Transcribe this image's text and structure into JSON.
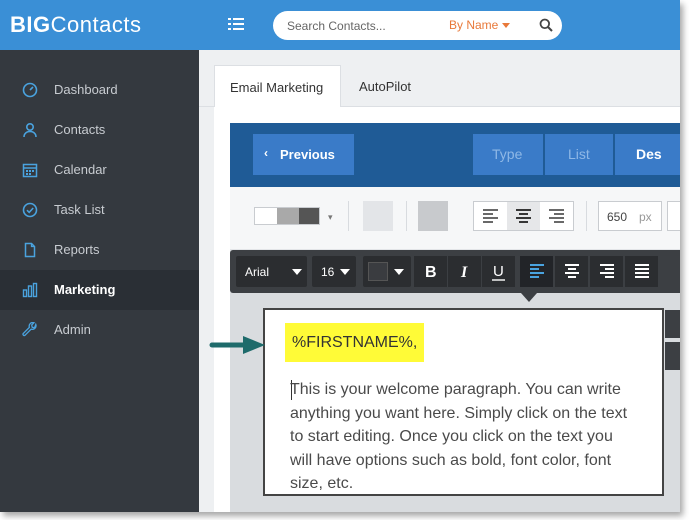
{
  "app": {
    "logo_bold": "BIG",
    "logo_light": "Contacts"
  },
  "search": {
    "placeholder": "Search Contacts...",
    "filter_label": "By Name"
  },
  "sidebar": {
    "items": [
      {
        "label": "Dashboard",
        "icon": "dashboard-gauge-icon",
        "active": false
      },
      {
        "label": "Contacts",
        "icon": "user-icon",
        "active": false
      },
      {
        "label": "Calendar",
        "icon": "calendar-icon",
        "active": false
      },
      {
        "label": "Task List",
        "icon": "check-circle-icon",
        "active": false
      },
      {
        "label": "Reports",
        "icon": "document-icon",
        "active": false
      },
      {
        "label": "Marketing",
        "icon": "bar-chart-icon",
        "active": true
      },
      {
        "label": "Admin",
        "icon": "wrench-icon",
        "active": false
      }
    ]
  },
  "tabs": [
    {
      "label": "Email Marketing",
      "active": true
    },
    {
      "label": "AutoPilot",
      "active": false
    }
  ],
  "wizard": {
    "previous_label": "Previous",
    "steps": [
      "Type",
      "List",
      "Des"
    ]
  },
  "style_toolbar": {
    "width_value": "650",
    "width_unit": "px"
  },
  "text_toolbar": {
    "font_family": "Arial",
    "font_size": "16"
  },
  "editor": {
    "merge_field": "%FIRSTNAME%,",
    "body_lines": [
      "This is your welcome paragraph. You can write",
      "anything you want here. Simply click on the text",
      "to start editing. Once you click on the text you",
      "will have options such as bold, font color, font",
      "size, etc."
    ]
  },
  "colors": {
    "topbar": "#3a8fd6",
    "sidebar": "#34393f",
    "wizard_bg": "#1f5b96",
    "wizard_step": "#3a7bc8",
    "search_filter": "#e8793a",
    "highlight": "#fffb37",
    "arrow": "#1e6b6b",
    "icon_blue": "#4aa3df"
  }
}
